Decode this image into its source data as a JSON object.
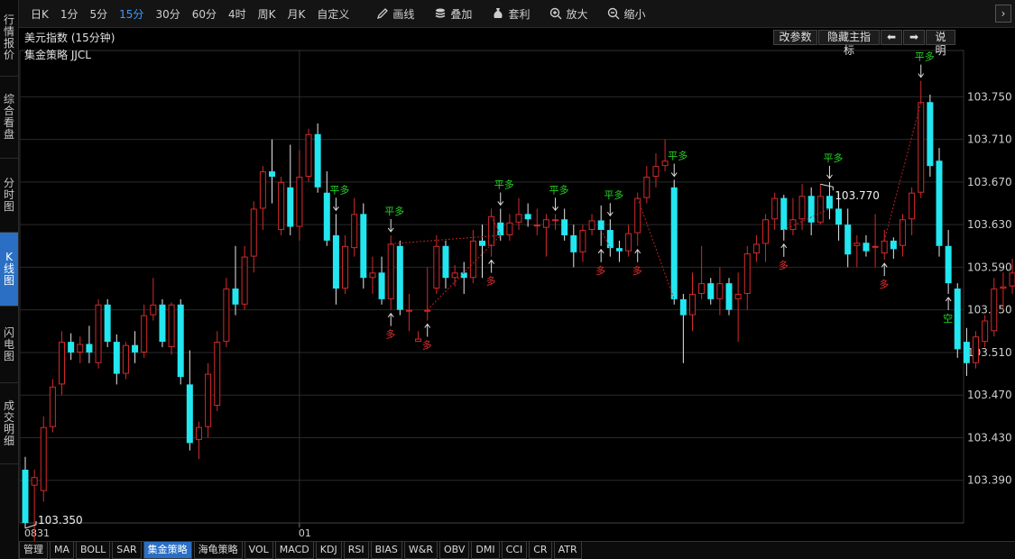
{
  "left_tabs": [
    {
      "label": "行情报价",
      "active": false
    },
    {
      "label": "综合看盘",
      "active": false
    },
    {
      "label": "分时图",
      "active": false
    },
    {
      "label": "K线图",
      "active": true
    },
    {
      "label": "闪电图",
      "active": false
    },
    {
      "label": "成交明细",
      "active": false
    }
  ],
  "toolbar": {
    "periods": [
      "日K",
      "1分",
      "5分",
      "15分",
      "30分",
      "60分",
      "4时",
      "周K",
      "月K",
      "自定义"
    ],
    "active_period": "15分",
    "tools": [
      {
        "label": "画线",
        "icon": "pencil-icon"
      },
      {
        "label": "叠加",
        "icon": "stack-icon"
      },
      {
        "label": "套利",
        "icon": "moneybag-icon"
      },
      {
        "label": "放大",
        "icon": "zoom-in-icon"
      },
      {
        "label": "缩小",
        "icon": "zoom-out-icon"
      }
    ],
    "right_arrow": "›"
  },
  "chart_header": {
    "title": "美元指数 (15分钟)",
    "strategy": "集金策略 JJCL",
    "buttons": [
      "改参数",
      "隐藏主指标",
      "⬅",
      "➡",
      "说明"
    ]
  },
  "bottom_tabs": {
    "items": [
      "管理",
      "MA",
      "BOLL",
      "SAR",
      "集金策略",
      "海龟策略",
      "VOL",
      "MACD",
      "KDJ",
      "RSI",
      "BIAS",
      "W&R",
      "OBV",
      "DMI",
      "CCI",
      "CR",
      "ATR"
    ],
    "active": "集金策略"
  },
  "colors": {
    "up": "#d42a2a",
    "down": "#22e6f0",
    "signal_flat": "#23d623",
    "signal_long": "#e83030",
    "grid": "#2a2a2a",
    "axis_text": "#cfcfcf"
  },
  "chart_data": {
    "type": "candlestick",
    "instrument": "美元指数",
    "period": "15分钟",
    "x_labels": [
      {
        "index": 0,
        "label": "0831"
      },
      {
        "index": 30,
        "label": "01"
      }
    ],
    "y_ticks": [
      103.39,
      103.43,
      103.47,
      103.51,
      103.55,
      103.59,
      103.63,
      103.67,
      103.71,
      103.75
    ],
    "ylim": [
      103.35,
      103.785
    ],
    "max_label": {
      "index": 87,
      "value": "103.770"
    },
    "min_label": {
      "index": 0,
      "value": "103.350"
    },
    "candles": [
      [
        103.4,
        103.412,
        103.345,
        103.35
      ],
      [
        103.385,
        103.4,
        103.33,
        103.393
      ],
      [
        103.38,
        103.45,
        103.37,
        103.44
      ],
      [
        103.44,
        103.485,
        103.435,
        103.478
      ],
      [
        103.48,
        103.53,
        103.47,
        103.52
      ],
      [
        103.52,
        103.528,
        103.503,
        103.51
      ],
      [
        103.51,
        103.525,
        103.5,
        103.518
      ],
      [
        103.518,
        103.535,
        103.5,
        103.51
      ],
      [
        103.5,
        103.56,
        103.495,
        103.555
      ],
      [
        103.555,
        103.56,
        103.515,
        103.52
      ],
      [
        103.52,
        103.527,
        103.48,
        103.49
      ],
      [
        103.49,
        103.52,
        103.485,
        103.517
      ],
      [
        103.517,
        103.53,
        103.5,
        103.51
      ],
      [
        103.51,
        103.555,
        103.505,
        103.545
      ],
      [
        103.545,
        103.58,
        103.54,
        103.555
      ],
      [
        103.555,
        103.56,
        103.515,
        103.52
      ],
      [
        103.515,
        103.557,
        103.508,
        103.555
      ],
      [
        103.555,
        103.56,
        103.48,
        103.487
      ],
      [
        103.48,
        103.512,
        103.418,
        103.425
      ],
      [
        103.428,
        103.445,
        103.41,
        103.44
      ],
      [
        103.44,
        103.5,
        103.43,
        103.49
      ],
      [
        103.46,
        103.53,
        103.455,
        103.52
      ],
      [
        103.52,
        103.58,
        103.515,
        103.57
      ],
      [
        103.57,
        103.61,
        103.545,
        103.555
      ],
      [
        103.555,
        103.61,
        103.55,
        103.6
      ],
      [
        103.6,
        103.652,
        103.585,
        103.645
      ],
      [
        103.645,
        103.685,
        103.625,
        103.68
      ],
      [
        103.68,
        103.71,
        103.65,
        103.675
      ],
      [
        103.625,
        103.675,
        103.62,
        103.67
      ],
      [
        103.665,
        103.705,
        103.62,
        103.628
      ],
      [
        103.628,
        103.7,
        103.615,
        103.675
      ],
      [
        103.675,
        103.72,
        103.67,
        103.715
      ],
      [
        103.715,
        103.725,
        103.66,
        103.665
      ],
      [
        103.66,
        103.68,
        103.61,
        103.615
      ],
      [
        103.62,
        103.64,
        103.555,
        103.57
      ],
      [
        103.57,
        103.62,
        103.565,
        103.61
      ],
      [
        103.608,
        103.655,
        103.6,
        103.64
      ],
      [
        103.64,
        103.65,
        103.57,
        103.58
      ],
      [
        103.58,
        103.6,
        103.565,
        103.585
      ],
      [
        103.585,
        103.6,
        103.555,
        103.56
      ],
      [
        103.56,
        103.62,
        103.55,
        103.612
      ],
      [
        103.61,
        103.615,
        103.545,
        103.55
      ],
      [
        103.55,
        103.565,
        103.53,
        103.55
      ],
      [
        103.52,
        103.53,
        103.52,
        103.523
      ],
      [
        103.55,
        103.59,
        103.54,
        103.55
      ],
      [
        103.57,
        103.62,
        103.565,
        103.61
      ],
      [
        103.61,
        103.615,
        103.57,
        103.58
      ],
      [
        103.58,
        103.592,
        103.572,
        103.585
      ],
      [
        103.585,
        103.595,
        103.565,
        103.58
      ],
      [
        103.58,
        103.625,
        103.575,
        103.615
      ],
      [
        103.615,
        103.63,
        103.58,
        103.61
      ],
      [
        103.61,
        103.645,
        103.6,
        103.638
      ],
      [
        103.632,
        103.645,
        103.615,
        103.62
      ],
      [
        103.62,
        103.64,
        103.615,
        103.632
      ],
      [
        103.632,
        103.655,
        103.625,
        103.64
      ],
      [
        103.64,
        103.65,
        103.628,
        103.635
      ],
      [
        103.63,
        103.645,
        103.62,
        103.63
      ],
      [
        103.627,
        103.64,
        103.6,
        103.635
      ],
      [
        103.635,
        103.64,
        103.625,
        103.635
      ],
      [
        103.635,
        103.645,
        103.615,
        103.62
      ],
      [
        103.62,
        103.63,
        103.59,
        103.604
      ],
      [
        103.604,
        103.63,
        103.595,
        103.625
      ],
      [
        103.625,
        103.64,
        103.62,
        103.634
      ],
      [
        103.634,
        103.648,
        103.61,
        103.625
      ],
      [
        103.625,
        103.635,
        103.6,
        103.608
      ],
      [
        103.608,
        103.615,
        103.595,
        103.605
      ],
      [
        103.605,
        103.63,
        103.6,
        103.622
      ],
      [
        103.622,
        103.66,
        103.61,
        103.655
      ],
      [
        103.655,
        103.685,
        103.65,
        103.675
      ],
      [
        103.675,
        103.697,
        103.665,
        103.685
      ],
      [
        103.685,
        103.71,
        103.68,
        103.69
      ],
      [
        103.665,
        103.672,
        103.555,
        103.56
      ],
      [
        103.56,
        103.565,
        103.5,
        103.545
      ],
      [
        103.545,
        103.585,
        103.53,
        103.565
      ],
      [
        103.565,
        103.61,
        103.56,
        103.575
      ],
      [
        103.575,
        103.58,
        103.555,
        103.56
      ],
      [
        103.56,
        103.59,
        103.545,
        103.575
      ],
      [
        103.575,
        103.58,
        103.545,
        103.55
      ],
      [
        103.56,
        103.585,
        103.52,
        103.565
      ],
      [
        103.565,
        103.61,
        103.55,
        103.603
      ],
      [
        103.603,
        103.62,
        103.595,
        103.612
      ],
      [
        103.612,
        103.64,
        103.595,
        103.635
      ],
      [
        103.635,
        103.66,
        103.625,
        103.655
      ],
      [
        103.655,
        103.658,
        103.615,
        103.625
      ],
      [
        103.625,
        103.655,
        103.62,
        103.635
      ],
      [
        103.635,
        103.668,
        103.625,
        103.657
      ],
      [
        103.657,
        103.665,
        103.62,
        103.632
      ],
      [
        103.632,
        103.668,
        103.63,
        103.657
      ],
      [
        103.657,
        103.67,
        103.635,
        103.645
      ],
      [
        103.645,
        103.66,
        103.615,
        103.63
      ],
      [
        103.63,
        103.645,
        103.59,
        103.602
      ],
      [
        103.61,
        103.62,
        103.59,
        103.613
      ],
      [
        103.613,
        103.62,
        103.6,
        103.605
      ],
      [
        103.61,
        103.64,
        103.59,
        103.61
      ],
      [
        103.603,
        103.625,
        103.597,
        103.615
      ],
      [
        103.615,
        103.618,
        103.598,
        103.607
      ],
      [
        103.61,
        103.64,
        103.6,
        103.635
      ],
      [
        103.635,
        103.665,
        103.62,
        103.66
      ],
      [
        103.66,
        103.765,
        103.655,
        103.745
      ],
      [
        103.745,
        103.752,
        103.675,
        103.685
      ],
      [
        103.69,
        103.702,
        103.6,
        103.61
      ],
      [
        103.61,
        103.625,
        103.565,
        103.575
      ],
      [
        103.57,
        103.575,
        103.505,
        103.513
      ],
      [
        103.52,
        103.533,
        103.488,
        103.5
      ],
      [
        103.5,
        103.53,
        103.495,
        103.525
      ],
      [
        103.52,
        103.545,
        103.515,
        103.54
      ],
      [
        103.53,
        103.58,
        103.525,
        103.57
      ],
      [
        103.57,
        103.585,
        103.55,
        103.572
      ],
      [
        103.572,
        103.598,
        103.565,
        103.585
      ],
      [
        103.585,
        103.605,
        103.56,
        103.595
      ]
    ],
    "signals": [
      {
        "index": 34,
        "type": "平多"
      },
      {
        "index": 40,
        "type": "多"
      },
      {
        "index": 40,
        "type": "平多"
      },
      {
        "index": 44,
        "type": "多"
      },
      {
        "index": 51,
        "type": "多"
      },
      {
        "index": 52,
        "type": "平多"
      },
      {
        "index": 58,
        "type": "平多"
      },
      {
        "index": 63,
        "type": "多"
      },
      {
        "index": 64,
        "type": "平多"
      },
      {
        "index": 67,
        "type": "多"
      },
      {
        "index": 71,
        "type": "平多"
      },
      {
        "index": 83,
        "type": "多"
      },
      {
        "index": 88,
        "type": "平多"
      },
      {
        "index": 94,
        "type": "多"
      },
      {
        "index": 98,
        "type": "平多"
      },
      {
        "index": 101,
        "type": "空"
      }
    ]
  }
}
